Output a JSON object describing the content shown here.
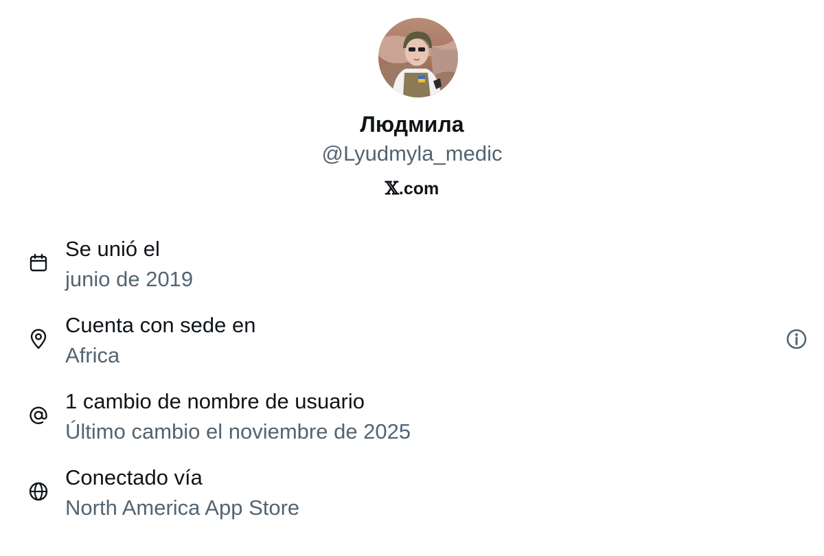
{
  "profile": {
    "display_name": "Людмила",
    "handle": "@Lyudmyla_medic",
    "site_x": "𝕏",
    "site_suffix": ".com"
  },
  "about": [
    {
      "icon": "calendar-icon",
      "title": "Se unió el",
      "value": "junio de 2019"
    },
    {
      "icon": "location-pin-icon",
      "title": "Cuenta con sede en",
      "value": "Africa"
    },
    {
      "icon": "at-sign-icon",
      "title": "1 cambio de nombre de usuario",
      "value": "Último cambio el noviembre de 2025"
    },
    {
      "icon": "globe-icon",
      "title": "Conectado vía",
      "value": "North America App Store"
    }
  ],
  "colors": {
    "primary_text": "#0f1419",
    "secondary_text": "#536471",
    "background": "#ffffff"
  }
}
